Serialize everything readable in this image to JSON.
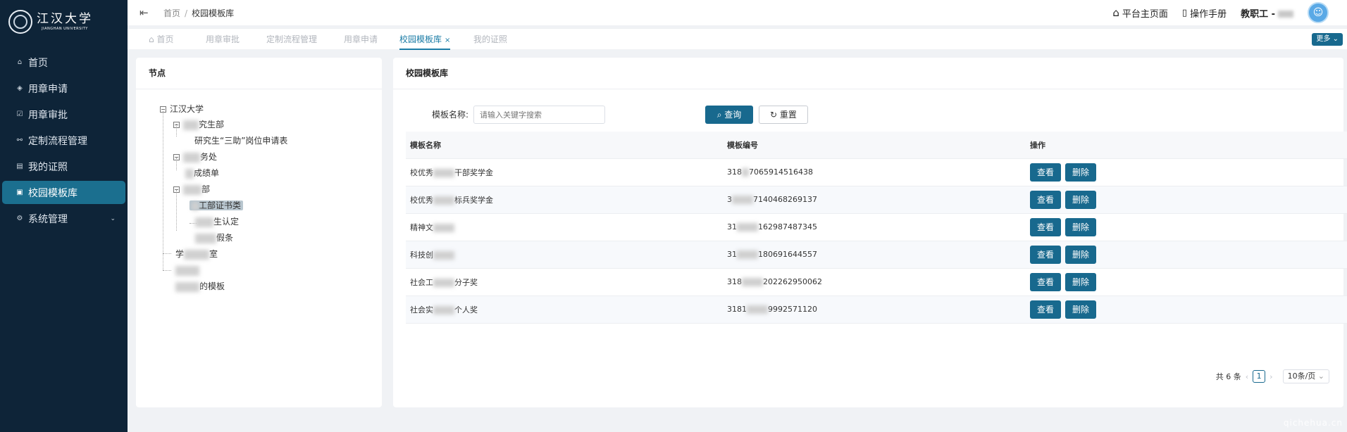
{
  "logo": {
    "name_cn": "江汉大学",
    "name_en": "JIANGHAN UNIVERSITY"
  },
  "sidebar": {
    "items": [
      {
        "label": "首页",
        "icon": "home-icon",
        "glyph": "⌂"
      },
      {
        "label": "用章申请",
        "icon": "stamp-icon",
        "glyph": "◈"
      },
      {
        "label": "用章审批",
        "icon": "approve-icon",
        "glyph": "☑"
      },
      {
        "label": "定制流程管理",
        "icon": "flow-icon",
        "glyph": "⚯"
      },
      {
        "label": "我的证照",
        "icon": "certificate-icon",
        "glyph": "▤"
      },
      {
        "label": "校园模板库",
        "icon": "template-icon",
        "glyph": "▣",
        "active": true
      },
      {
        "label": "系统管理",
        "icon": "settings-icon",
        "glyph": "⚙",
        "caret": "⌄"
      }
    ]
  },
  "header": {
    "breadcrumb": [
      "首页",
      "校园模板库"
    ],
    "platform_home": "平台主页面",
    "manual": "操作手册",
    "user_label": "教职工 -"
  },
  "tabs": [
    {
      "label": "首页"
    },
    {
      "label": "用章审批"
    },
    {
      "label": "定制流程管理"
    },
    {
      "label": "用章申请"
    },
    {
      "label": "校园模板库",
      "active": true,
      "close": "×"
    },
    {
      "label": "我的证照"
    }
  ],
  "more_button": "更多",
  "tree_panel": {
    "title": "节点",
    "root": "江汉大学",
    "nodes": {
      "n1_suffix": "究生部",
      "n1_child": "研究生“三助”岗位申请表",
      "n2_suffix": "务处",
      "n2_child": "成绩单",
      "n3_suffix": "部",
      "n3_child1": "工部证书类",
      "n3_child2": "生认定",
      "n3_child3": "假条",
      "n4": "学",
      "n4_suffix": "室",
      "n5": "",
      "n6_suffix": "的模板"
    }
  },
  "main_panel": {
    "title": "校园模板库",
    "search": {
      "label": "模板名称:",
      "placeholder": "请输入关键字搜索",
      "query_btn": "查询",
      "reset_btn": "重置"
    },
    "columns": [
      "模板名称",
      "模板编号",
      "操作"
    ],
    "rows": [
      {
        "name_a": "校优秀",
        "name_b": "干部奖学金",
        "code_a": "318",
        "code_b": "7065914516438"
      },
      {
        "name_a": "校优秀",
        "name_b": "标兵奖学金",
        "code_a": "3",
        "code_b": "7140468269137"
      },
      {
        "name_a": "精神文",
        "name_b": "",
        "code_a": "31",
        "code_b": "162987487345"
      },
      {
        "name_a": "科技创",
        "name_b": "",
        "code_a": "31",
        "code_b": "180691644557"
      },
      {
        "name_a": "社会工",
        "name_b": "分子奖",
        "code_a": "318",
        "code_b": "202262950062"
      },
      {
        "name_a": "社会实",
        "name_b": "个人奖",
        "code_a": "3181",
        "code_b": "9992571120"
      }
    ],
    "view_label": "查看",
    "delete_label": "删除",
    "pager": {
      "total": "共 6 条",
      "page": "1",
      "size": "10条/页"
    }
  },
  "watermark": "qichehua.cn"
}
